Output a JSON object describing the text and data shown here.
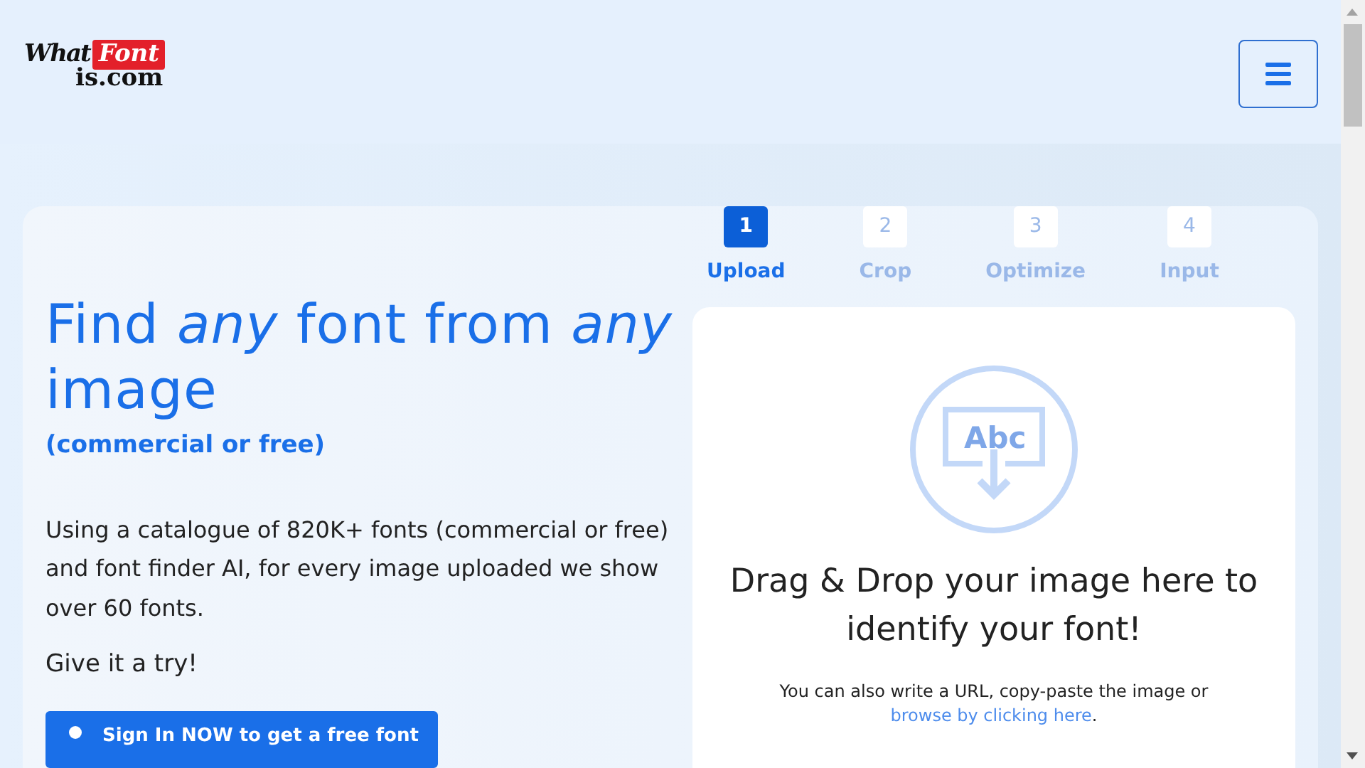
{
  "logo": {
    "word_1": "What",
    "word_2": "Font",
    "word_3": "is.com"
  },
  "hero": {
    "heading": "Find *any* font from *any* image",
    "subheading": "(commercial or free)",
    "description": "Using a catalogue of 820K+ fonts (commercial or free) and font finder AI, for every image uploaded we show over 60 fonts.",
    "prompt": "Give it a try!",
    "button": "Sign In NOW to get a free font"
  },
  "steps": [
    {
      "number": "1",
      "label": "Upload",
      "selected": true
    },
    {
      "number": "2",
      "label": "Crop",
      "selected": false
    },
    {
      "number": "3",
      "label": "Optimize",
      "selected": false
    },
    {
      "number": "4",
      "label": "Input",
      "selected": false
    }
  ],
  "dropzone": {
    "icon_text": "Abc",
    "title": "Drag & Drop your image here to identify your font!",
    "hint": "You can also write a URL, copy-paste the image or",
    "link": "browse by clicking here",
    "hint_end": "."
  }
}
